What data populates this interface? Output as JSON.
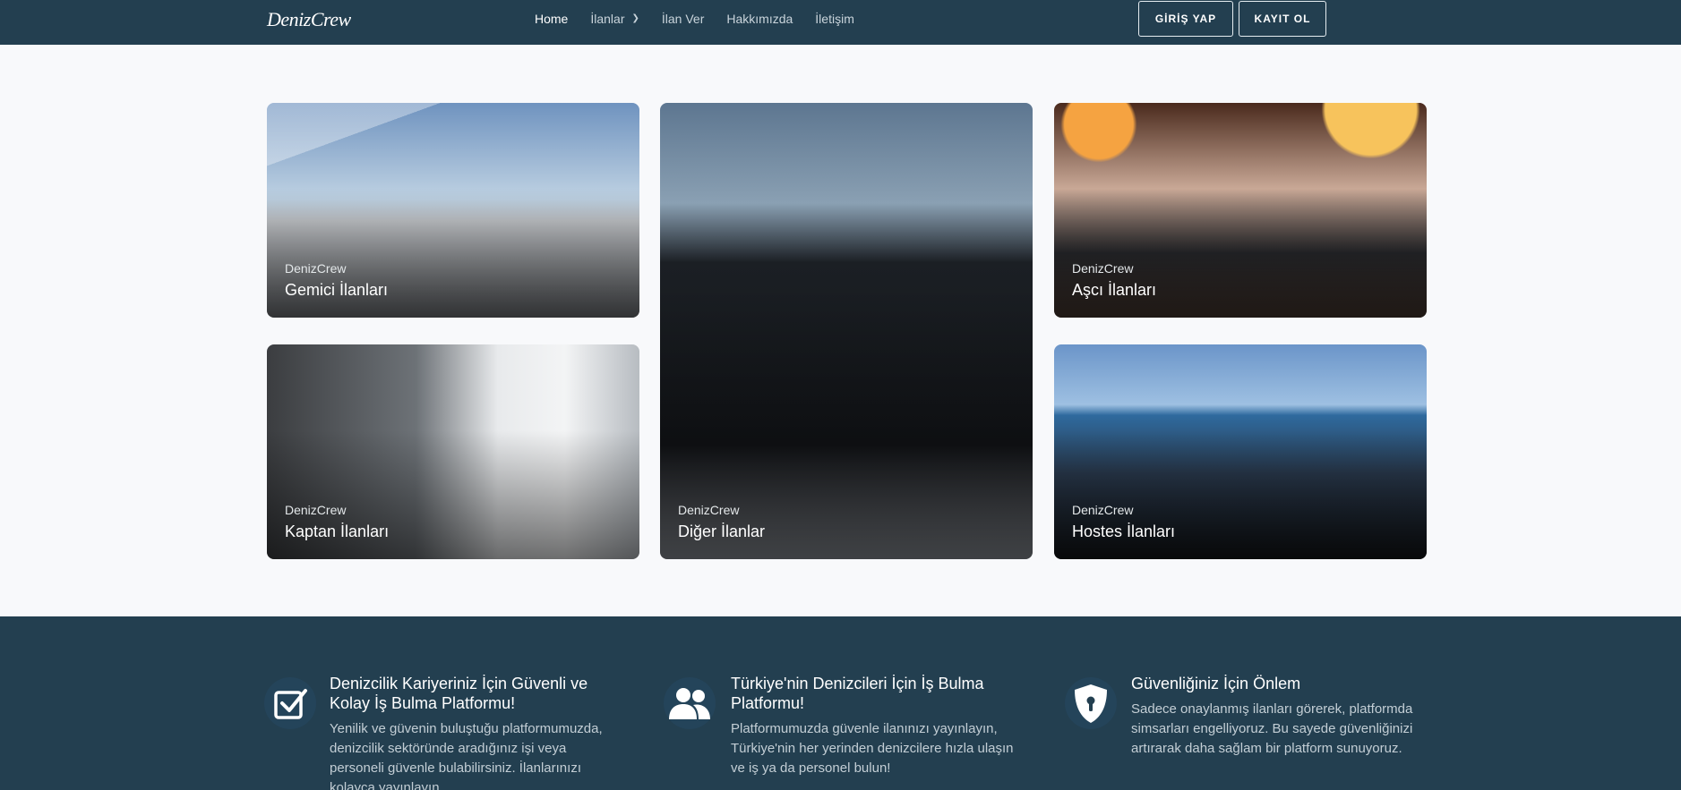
{
  "brand": {
    "logo": "DenizCrew"
  },
  "nav": {
    "items": [
      {
        "label": "Home",
        "active": true
      },
      {
        "label": "İlanlar",
        "dropdown": true
      },
      {
        "label": "İlan Ver"
      },
      {
        "label": "Hakkımızda"
      },
      {
        "label": "İletişim"
      }
    ],
    "login": "GİRİŞ YAP",
    "register": "KAYIT OL"
  },
  "cards": [
    {
      "subtitle": "DenizCrew",
      "title": "Gemici İlanları"
    },
    {
      "subtitle": "DenizCrew",
      "title": "Diğer İlanlar"
    },
    {
      "subtitle": "DenizCrew",
      "title": "Aşcı İlanları"
    },
    {
      "subtitle": "DenizCrew",
      "title": "Kaptan İlanları"
    },
    {
      "subtitle": "DenizCrew",
      "title": "Hostes İlanları"
    }
  ],
  "features": [
    {
      "icon": "checkbox-icon",
      "title": "Denizcilik Kariyeriniz İçin Güvenli ve Kolay İş Bulma Platformu!",
      "desc": "Yenilik ve güvenin buluştuğu platformumuzda, denizcilik sektöründe aradığınız işi veya personeli güvenle bulabilirsiniz. İlanlarınızı kolayca yayınlayın"
    },
    {
      "icon": "users-icon",
      "title": "Türkiye'nin Denizcileri İçin İş Bulma Platformu!",
      "desc": "Platformumuzda güvenle ilanınızı yayınlayın, Türkiye'nin her yerinden denizcilere hızla ulaşın ve iş ya da personel bulun!"
    },
    {
      "icon": "shield-lock-icon",
      "title": "Güvenliğiniz İçin Önlem",
      "desc": "Sadece onaylanmış ilanları görerek, platformda simsarları engelliyoruz. Bu sayede güvenliğinizi artırarak daha sağlam bir platform sunuyoruz."
    }
  ],
  "colors": {
    "navy": "#233f50",
    "page_bg": "#f8f9fb"
  }
}
